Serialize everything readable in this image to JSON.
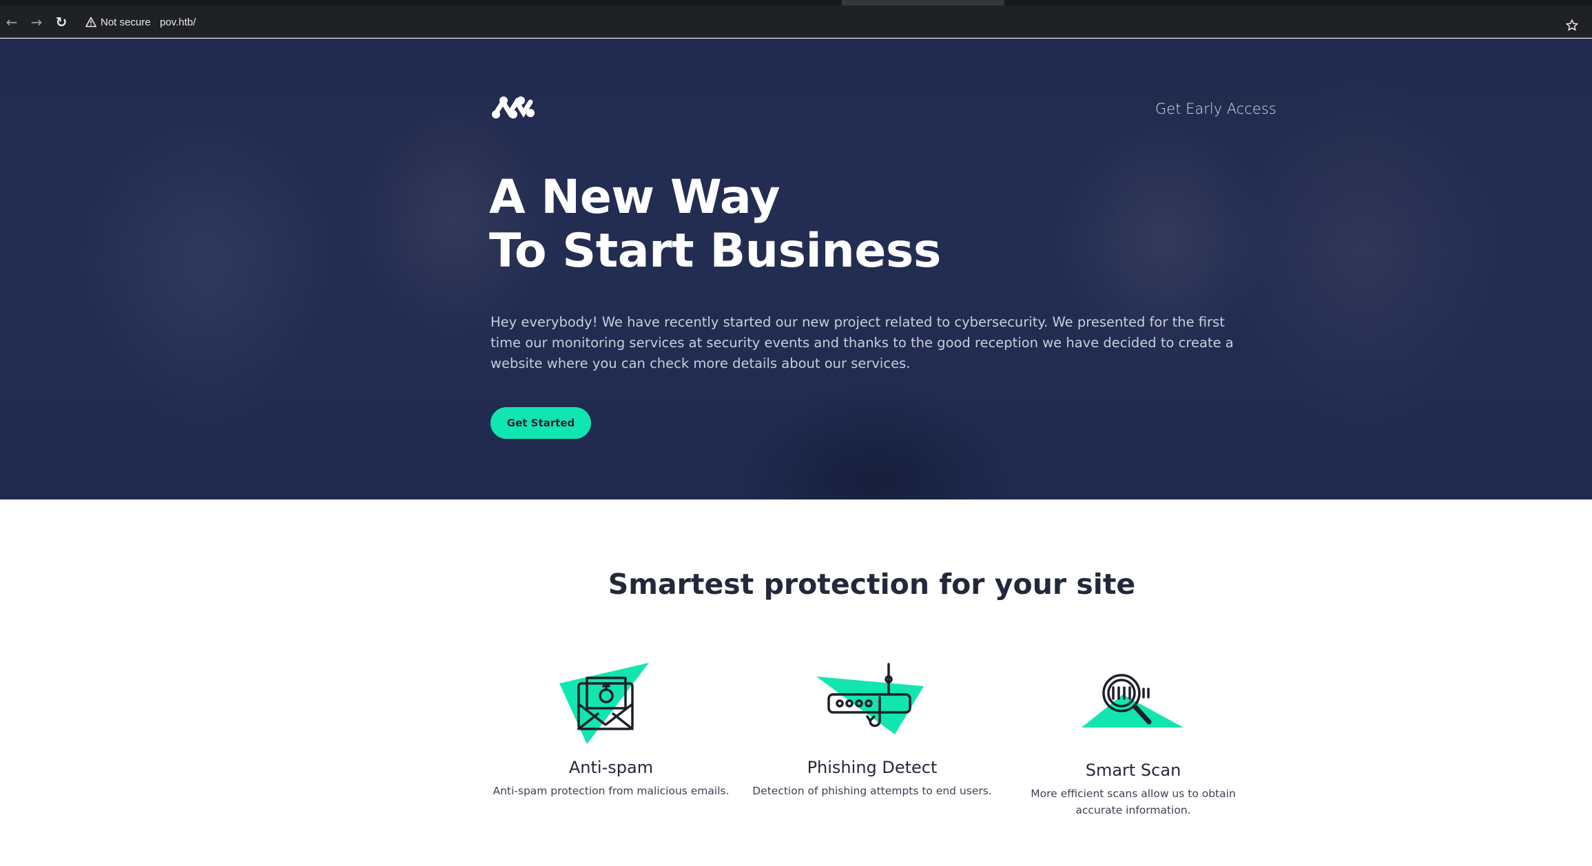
{
  "browser": {
    "security_label": "Not secure",
    "url": "pov.htb/",
    "icons": [
      "back-arrow-icon",
      "forward-arrow-icon",
      "reload-icon",
      "warning-icon",
      "bookmark-star-icon"
    ]
  },
  "header": {
    "logo_icon": "brand-logo-icon",
    "nav_link": "Get Early Access"
  },
  "hero": {
    "title_line1": "A New Way",
    "title_line2": "To Start Business",
    "description": "Hey everybody! We have recently started our new project related to cybersecurity. We presented for the first time our monitoring services at security events and thanks to the good reception we have decided to create a website where you can check more details about our services.",
    "cta_label": "Get Started"
  },
  "features": {
    "title": "Smartest protection for your site",
    "accent_color": "#12e6b0",
    "items": [
      {
        "icon": "bomb-envelope-icon",
        "title": "Anti-spam",
        "description": "Anti-spam protection from malicious emails."
      },
      {
        "icon": "phishing-hook-icon",
        "title": "Phishing Detect",
        "description": "Detection of phishing attempts to end users."
      },
      {
        "icon": "magnifier-scan-icon",
        "title": "Smart Scan",
        "description": "More efficient scans allow us to obtain accurate information."
      }
    ]
  },
  "colors": {
    "accent": "#12e6b0",
    "hero_overlay": "#26325a",
    "heading_text": "#24283b"
  }
}
